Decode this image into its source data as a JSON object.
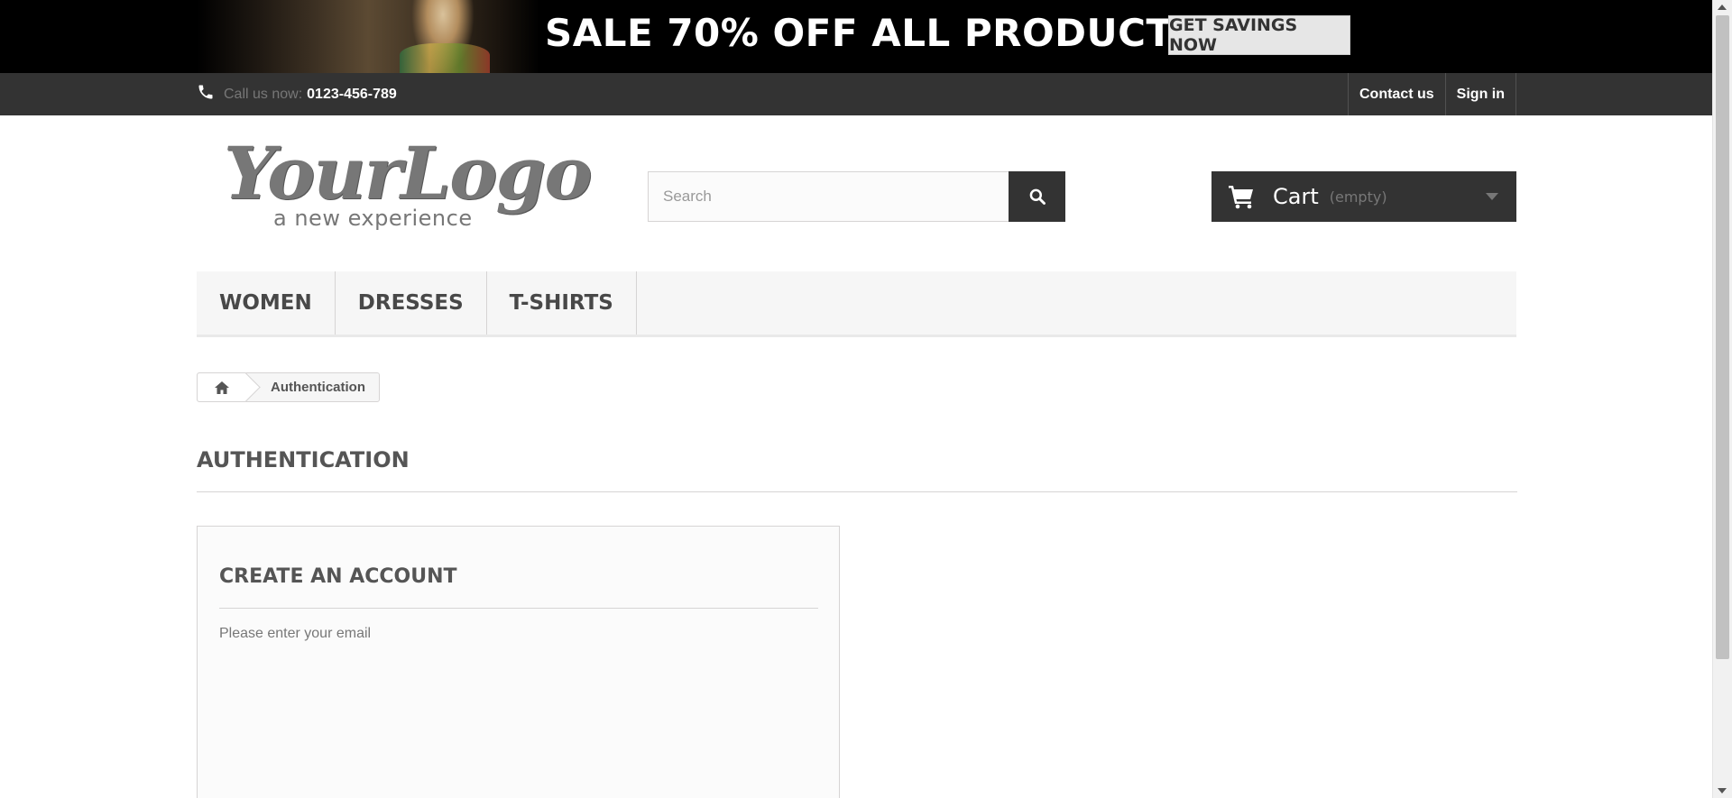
{
  "promo": {
    "headline": "SALE 70% OFF ALL PRODUCTS",
    "button_label": "GET SAVINGS NOW"
  },
  "topbar": {
    "call_label": "Call us now:",
    "phone_number": "0123-456-789",
    "links": [
      "Contact us",
      "Sign in"
    ]
  },
  "header": {
    "logo_main": "YourLogo",
    "logo_tagline": "a new experience",
    "search_placeholder": "Search",
    "cart_label": "Cart",
    "cart_quantity": "(empty)"
  },
  "menu": {
    "items": [
      "WOMEN",
      "DRESSES",
      "T-SHIRTS"
    ]
  },
  "breadcrumb": {
    "current": "Authentication"
  },
  "page": {
    "title": "AUTHENTICATION"
  },
  "create_account": {
    "title": "CREATE AN ACCOUNT",
    "instruction": "Please enter your email"
  },
  "colors": {
    "dark": "#333333",
    "banner": "#000000",
    "menu_bg": "#f6f6f6",
    "border": "#d6d4d4"
  },
  "icons": [
    "phone-icon",
    "search-icon",
    "cart-icon",
    "home-icon",
    "chevron-down-icon"
  ]
}
